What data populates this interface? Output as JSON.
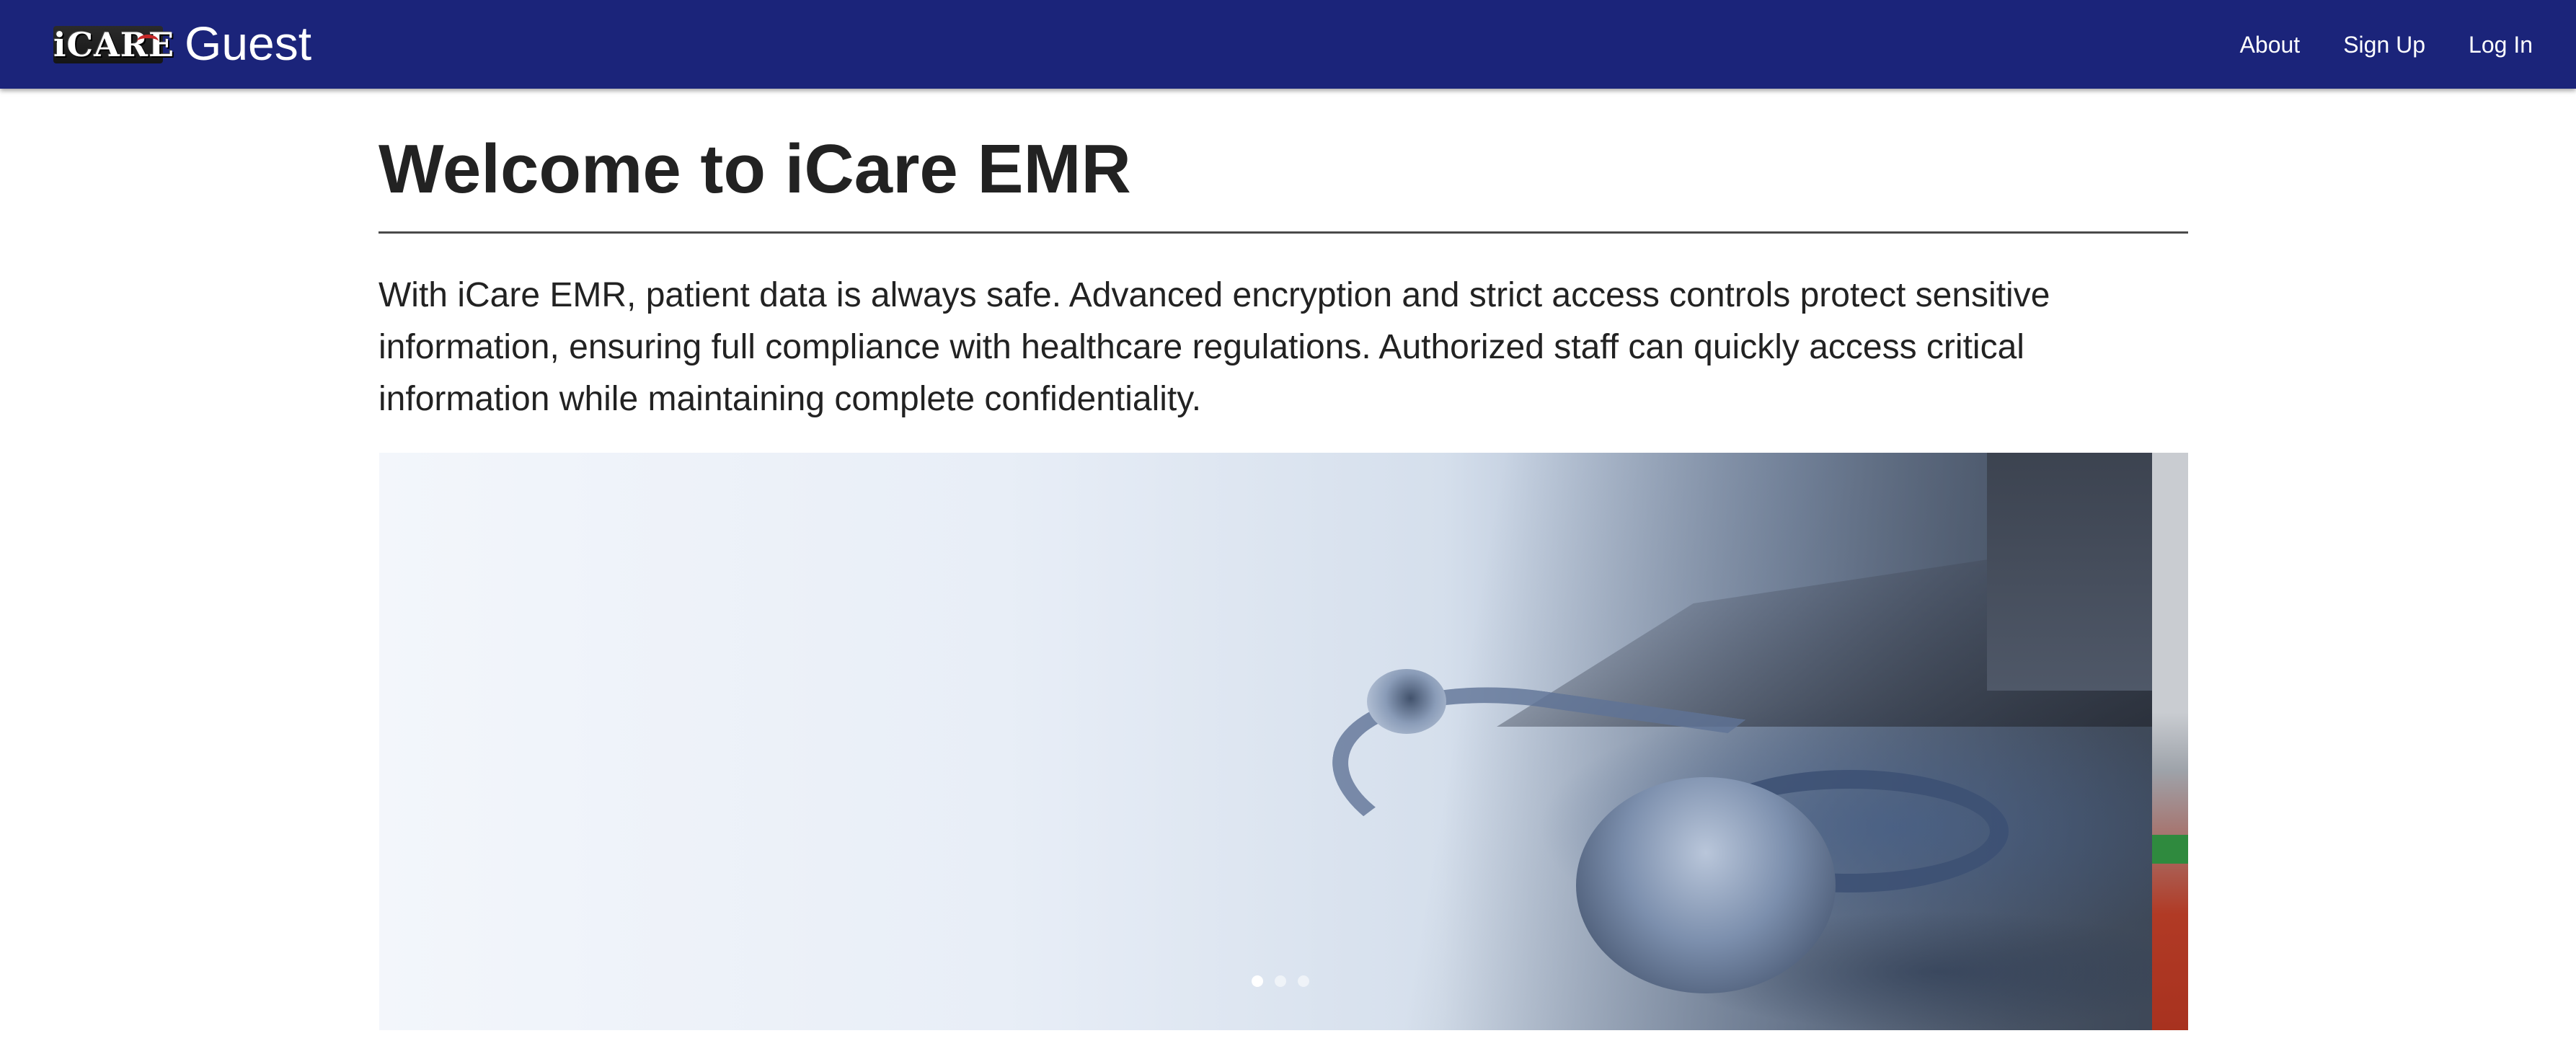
{
  "navbar": {
    "logo_text": "iCARE",
    "brand_name": "Guest",
    "links": [
      {
        "label": "About"
      },
      {
        "label": "Sign Up"
      },
      {
        "label": "Log In"
      }
    ],
    "background_color": "#1b247a"
  },
  "main": {
    "title": "Welcome to iCare EMR",
    "intro": "With iCare EMR, patient data is always safe. Advanced encryption and strict access controls protect sensitive information, ensuring full compliance with healthcare regulations. Authorized staff can quickly access critical information while maintaining complete confidentiality."
  },
  "carousel": {
    "slide_count": 3,
    "active_slide": 1,
    "current_image": "stethoscope-and-laptop"
  }
}
